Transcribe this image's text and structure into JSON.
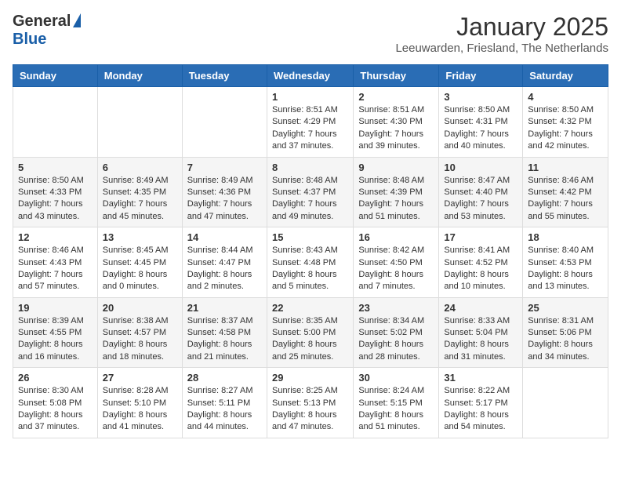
{
  "header": {
    "logo_general": "General",
    "logo_blue": "Blue",
    "month_title": "January 2025",
    "location": "Leeuwarden, Friesland, The Netherlands"
  },
  "days_of_week": [
    "Sunday",
    "Monday",
    "Tuesday",
    "Wednesday",
    "Thursday",
    "Friday",
    "Saturday"
  ],
  "weeks": [
    [
      {
        "day": "",
        "content": ""
      },
      {
        "day": "",
        "content": ""
      },
      {
        "day": "",
        "content": ""
      },
      {
        "day": "1",
        "content": "Sunrise: 8:51 AM\nSunset: 4:29 PM\nDaylight: 7 hours\nand 37 minutes."
      },
      {
        "day": "2",
        "content": "Sunrise: 8:51 AM\nSunset: 4:30 PM\nDaylight: 7 hours\nand 39 minutes."
      },
      {
        "day": "3",
        "content": "Sunrise: 8:50 AM\nSunset: 4:31 PM\nDaylight: 7 hours\nand 40 minutes."
      },
      {
        "day": "4",
        "content": "Sunrise: 8:50 AM\nSunset: 4:32 PM\nDaylight: 7 hours\nand 42 minutes."
      }
    ],
    [
      {
        "day": "5",
        "content": "Sunrise: 8:50 AM\nSunset: 4:33 PM\nDaylight: 7 hours\nand 43 minutes."
      },
      {
        "day": "6",
        "content": "Sunrise: 8:49 AM\nSunset: 4:35 PM\nDaylight: 7 hours\nand 45 minutes."
      },
      {
        "day": "7",
        "content": "Sunrise: 8:49 AM\nSunset: 4:36 PM\nDaylight: 7 hours\nand 47 minutes."
      },
      {
        "day": "8",
        "content": "Sunrise: 8:48 AM\nSunset: 4:37 PM\nDaylight: 7 hours\nand 49 minutes."
      },
      {
        "day": "9",
        "content": "Sunrise: 8:48 AM\nSunset: 4:39 PM\nDaylight: 7 hours\nand 51 minutes."
      },
      {
        "day": "10",
        "content": "Sunrise: 8:47 AM\nSunset: 4:40 PM\nDaylight: 7 hours\nand 53 minutes."
      },
      {
        "day": "11",
        "content": "Sunrise: 8:46 AM\nSunset: 4:42 PM\nDaylight: 7 hours\nand 55 minutes."
      }
    ],
    [
      {
        "day": "12",
        "content": "Sunrise: 8:46 AM\nSunset: 4:43 PM\nDaylight: 7 hours\nand 57 minutes."
      },
      {
        "day": "13",
        "content": "Sunrise: 8:45 AM\nSunset: 4:45 PM\nDaylight: 8 hours\nand 0 minutes."
      },
      {
        "day": "14",
        "content": "Sunrise: 8:44 AM\nSunset: 4:47 PM\nDaylight: 8 hours\nand 2 minutes."
      },
      {
        "day": "15",
        "content": "Sunrise: 8:43 AM\nSunset: 4:48 PM\nDaylight: 8 hours\nand 5 minutes."
      },
      {
        "day": "16",
        "content": "Sunrise: 8:42 AM\nSunset: 4:50 PM\nDaylight: 8 hours\nand 7 minutes."
      },
      {
        "day": "17",
        "content": "Sunrise: 8:41 AM\nSunset: 4:52 PM\nDaylight: 8 hours\nand 10 minutes."
      },
      {
        "day": "18",
        "content": "Sunrise: 8:40 AM\nSunset: 4:53 PM\nDaylight: 8 hours\nand 13 minutes."
      }
    ],
    [
      {
        "day": "19",
        "content": "Sunrise: 8:39 AM\nSunset: 4:55 PM\nDaylight: 8 hours\nand 16 minutes."
      },
      {
        "day": "20",
        "content": "Sunrise: 8:38 AM\nSunset: 4:57 PM\nDaylight: 8 hours\nand 18 minutes."
      },
      {
        "day": "21",
        "content": "Sunrise: 8:37 AM\nSunset: 4:58 PM\nDaylight: 8 hours\nand 21 minutes."
      },
      {
        "day": "22",
        "content": "Sunrise: 8:35 AM\nSunset: 5:00 PM\nDaylight: 8 hours\nand 25 minutes."
      },
      {
        "day": "23",
        "content": "Sunrise: 8:34 AM\nSunset: 5:02 PM\nDaylight: 8 hours\nand 28 minutes."
      },
      {
        "day": "24",
        "content": "Sunrise: 8:33 AM\nSunset: 5:04 PM\nDaylight: 8 hours\nand 31 minutes."
      },
      {
        "day": "25",
        "content": "Sunrise: 8:31 AM\nSunset: 5:06 PM\nDaylight: 8 hours\nand 34 minutes."
      }
    ],
    [
      {
        "day": "26",
        "content": "Sunrise: 8:30 AM\nSunset: 5:08 PM\nDaylight: 8 hours\nand 37 minutes."
      },
      {
        "day": "27",
        "content": "Sunrise: 8:28 AM\nSunset: 5:10 PM\nDaylight: 8 hours\nand 41 minutes."
      },
      {
        "day": "28",
        "content": "Sunrise: 8:27 AM\nSunset: 5:11 PM\nDaylight: 8 hours\nand 44 minutes."
      },
      {
        "day": "29",
        "content": "Sunrise: 8:25 AM\nSunset: 5:13 PM\nDaylight: 8 hours\nand 47 minutes."
      },
      {
        "day": "30",
        "content": "Sunrise: 8:24 AM\nSunset: 5:15 PM\nDaylight: 8 hours\nand 51 minutes."
      },
      {
        "day": "31",
        "content": "Sunrise: 8:22 AM\nSunset: 5:17 PM\nDaylight: 8 hours\nand 54 minutes."
      },
      {
        "day": "",
        "content": ""
      }
    ]
  ]
}
